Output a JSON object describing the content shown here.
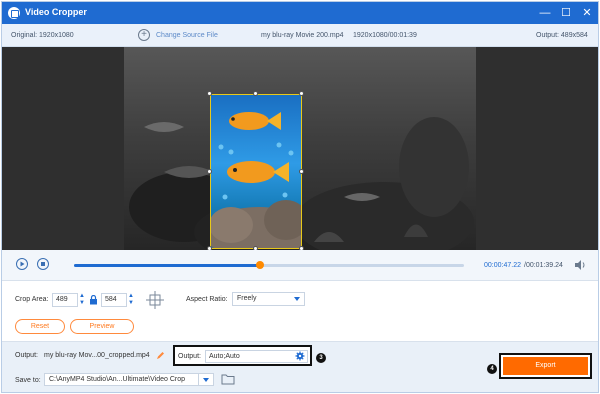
{
  "window": {
    "title": "Video Cropper",
    "controls": {
      "minimize": "—",
      "maximize": "☐",
      "close": "✕"
    }
  },
  "info_bar": {
    "original": "Original: 1920x1080",
    "change_source": "Change Source File",
    "file_name": "my blu-ray Movie 200.mp4",
    "file_meta": "1920x1080/00:01:39",
    "output": "Output: 489x584"
  },
  "playback": {
    "progress_fraction": 0.477,
    "current_time": "00:00:47.22",
    "total_time": "/00:01:39.24"
  },
  "crop": {
    "area_label": "Crop Area:",
    "width": "489",
    "height": "584",
    "aspect_label": "Aspect Ratio:",
    "aspect_value": "Freely",
    "reset_label": "Reset",
    "preview_label": "Preview"
  },
  "output": {
    "label": "Output:",
    "file_name": "my blu-ray Mov...00_cropped.mp4",
    "settings_label": "Output:",
    "settings_value": "Auto;Auto",
    "marker_3": "3",
    "save_label": "Save to:",
    "save_path": "C:\\AnyMP4 Studio\\An...Ultimate\\Video Crop",
    "marker_4": "4",
    "export_label": "Export"
  },
  "colors": {
    "accent": "#1f6bd1",
    "export": "#ff6a00",
    "crop_frame": "#e8c919",
    "pill": "#ff8a3d"
  }
}
